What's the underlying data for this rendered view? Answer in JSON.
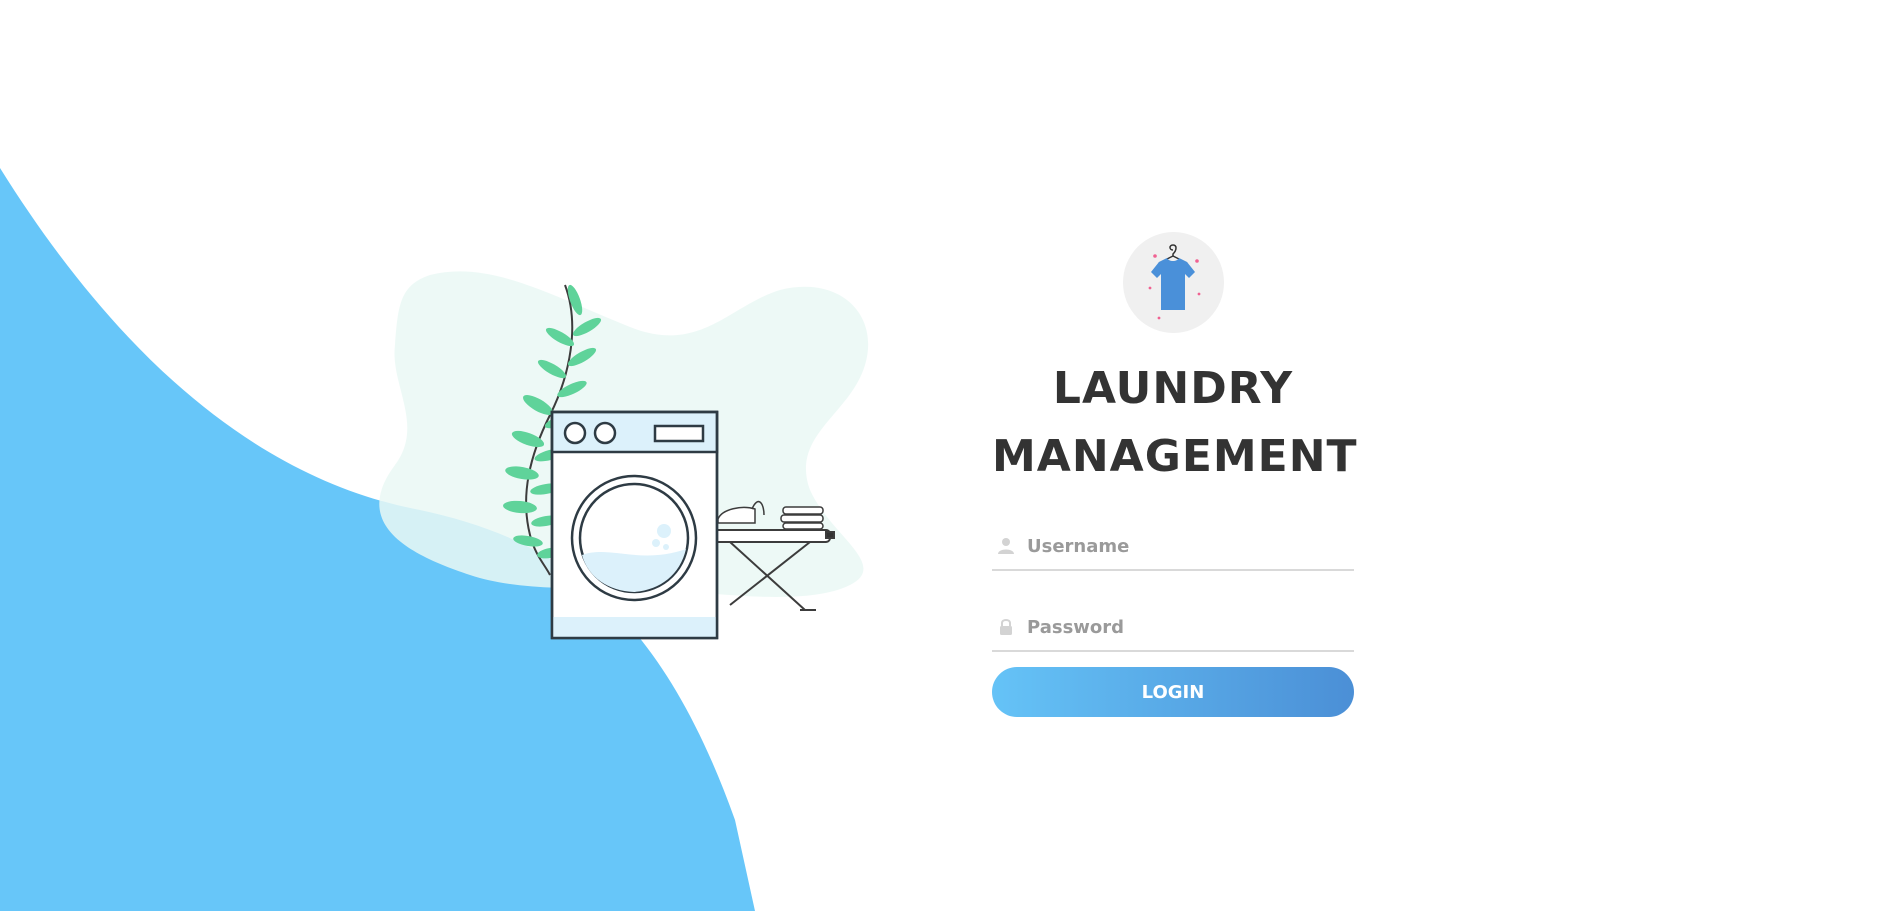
{
  "app": {
    "title": "LAUNDRY MANAGEMENT",
    "title_line1": "LAUNDRY",
    "title_line2": "MANAGEMENT"
  },
  "logo": {
    "icon": "tshirt-on-hanger-icon",
    "shirt_color": "#4a90d9",
    "sparkle_color": "#f06292",
    "background": "#f0f0f0"
  },
  "illustration": {
    "subject": "washing-machine-ironing-board-plant",
    "blob_color": "#eaf8f4",
    "leaf_color": "#5fd39a",
    "machine_accent": "#dcf1fb"
  },
  "form": {
    "username": {
      "icon": "user-icon",
      "placeholder": "Username",
      "value": ""
    },
    "password": {
      "icon": "lock-icon",
      "placeholder": "Password",
      "value": ""
    },
    "login_label": "LOGIN"
  },
  "theme": {
    "wave_color": "#67c6f9",
    "button_gradient_start": "#65c3f7",
    "button_gradient_end": "#4b8fd6",
    "text_color": "#333333"
  }
}
